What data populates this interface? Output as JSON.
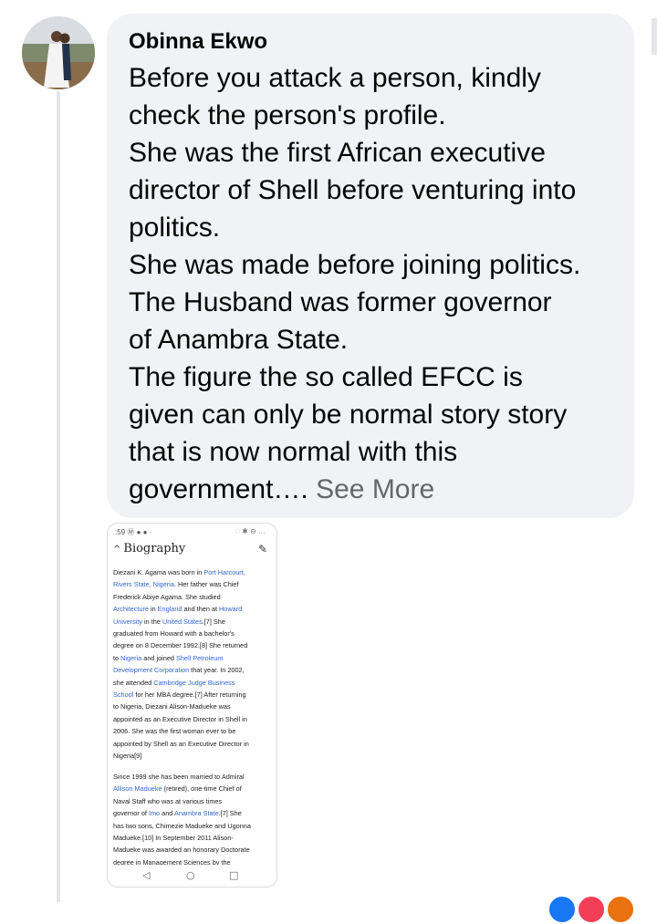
{
  "comment": {
    "author": "Obinna Ekwo",
    "lines": [
      "Before you attack a person, kindly",
      "check the person's profile.",
      "She was the first African executive",
      "director of Shell before venturing into",
      "politics.",
      "She was made before joining politics.",
      "The Husband was former governor",
      "of Anambra State.",
      "The figure the so called EFCC is",
      "given can only be normal story story",
      "that is now normal with this"
    ],
    "last_line": "government….",
    "see_more": " See More"
  },
  "screenshot": {
    "status_time": ":59",
    "status_icons": "Ⓜ ● ● ·",
    "status_right": "◌ ✱ ⊖ …",
    "section_title": "Biography",
    "para1": [
      [
        "Diezani K. Agama was born in ",
        {
          "link": "Port Harcourt,"
        }
      ],
      [
        {
          "link": "Rivers State, Nigeria"
        },
        ". Her father was Chief"
      ],
      [
        "Frederick Abiye Agama. She studied"
      ],
      [
        {
          "link": "Architecture"
        },
        " in ",
        {
          "link": "England"
        },
        " and then at ",
        {
          "link": "Howard"
        }
      ],
      [
        {
          "link": "University"
        },
        " in the ",
        {
          "link": "United States"
        },
        ".[7] She"
      ],
      [
        "graduated from Howard with a bachelor's"
      ],
      [
        "degree on 8 December 1992.[8] She returned"
      ],
      [
        "to ",
        {
          "link": "Nigeria"
        },
        " and joined ",
        {
          "link": "Shell Petroleum"
        }
      ],
      [
        {
          "link": "Development Corporation"
        },
        " that year. In 2002,"
      ],
      [
        "she attended ",
        {
          "link": "Cambridge Judge Business"
        }
      ],
      [
        {
          "link": "School"
        },
        " for her MBA degree.[7] After returning"
      ],
      [
        "to Nigeria, Diezani Alison-Madueke was"
      ],
      [
        "appointed as an Executive Director in Shell in"
      ],
      [
        "2006. She was the first woman ever to be"
      ],
      [
        "appointed by Shell as an Executive Director in"
      ],
      [
        "Nigeria[9]"
      ]
    ],
    "para2": [
      [
        "Since 1999 she has been married to Admiral"
      ],
      [
        {
          "link": "Allison Madueke"
        },
        " (retired), one-time Chief of"
      ],
      [
        "Naval Staff who was at various times"
      ],
      [
        "governor of ",
        {
          "link": "Imo"
        },
        " and ",
        {
          "link": "Anambra State"
        },
        ".[7] She"
      ],
      [
        "has two sons, Chimezie Madueke and Ugonna"
      ],
      [
        "Madueke.[10] In September 2011 Alison-"
      ],
      [
        "Madueke was awarded an honorary Doctorate"
      ],
      [
        "degree in Management Sciences by the"
      ]
    ],
    "nav_back": "◁",
    "nav_home": "○",
    "nav_recent": "□"
  },
  "reactions": {
    "colors": [
      "#1877f2",
      "#f33e58",
      "#e9710f"
    ]
  }
}
